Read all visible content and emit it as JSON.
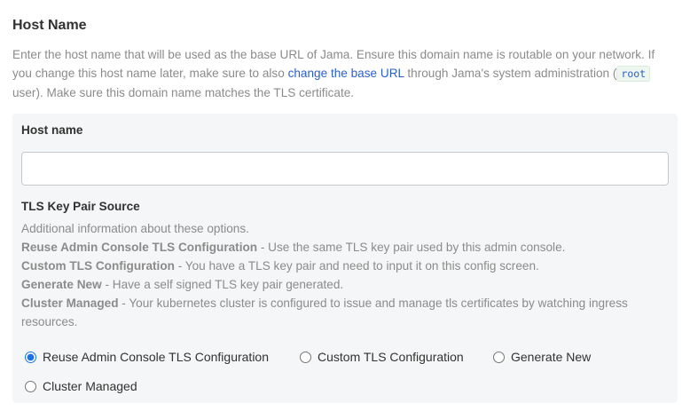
{
  "section": {
    "title": "Host Name",
    "help_part1": "Enter the host name that will be used as the base URL of Jama. Ensure this domain name is routable on your network. If you change this host name later, make sure to also ",
    "help_link": "change the base URL",
    "help_part2": " through Jama's system administration (",
    "help_code": "root",
    "help_part3": " user). Make sure this domain name matches the TLS certificate."
  },
  "hostname_field": {
    "label": "Host name",
    "value": "",
    "placeholder": ""
  },
  "tls": {
    "label": "TLS Key Pair Source",
    "intro": "Additional information about these options.",
    "descriptions": [
      {
        "name": "Reuse Admin Console TLS Configuration",
        "text": " - Use the same TLS key pair used by this admin console."
      },
      {
        "name": "Custom TLS Configuration",
        "text": " - You have a TLS key pair and need to input it on this config screen."
      },
      {
        "name": "Generate New",
        "text": " - Have a self signed TLS key pair generated."
      },
      {
        "name": "Cluster Managed",
        "text": " - Your kubernetes cluster is configured to issue and manage tls certificates by watching ingress resources."
      }
    ],
    "options": [
      {
        "label": "Reuse Admin Console TLS Configuration",
        "selected": true
      },
      {
        "label": "Custom TLS Configuration",
        "selected": false
      },
      {
        "label": "Generate New",
        "selected": false
      },
      {
        "label": "Cluster Managed",
        "selected": false
      }
    ],
    "accent_color": "#1a73e8"
  }
}
